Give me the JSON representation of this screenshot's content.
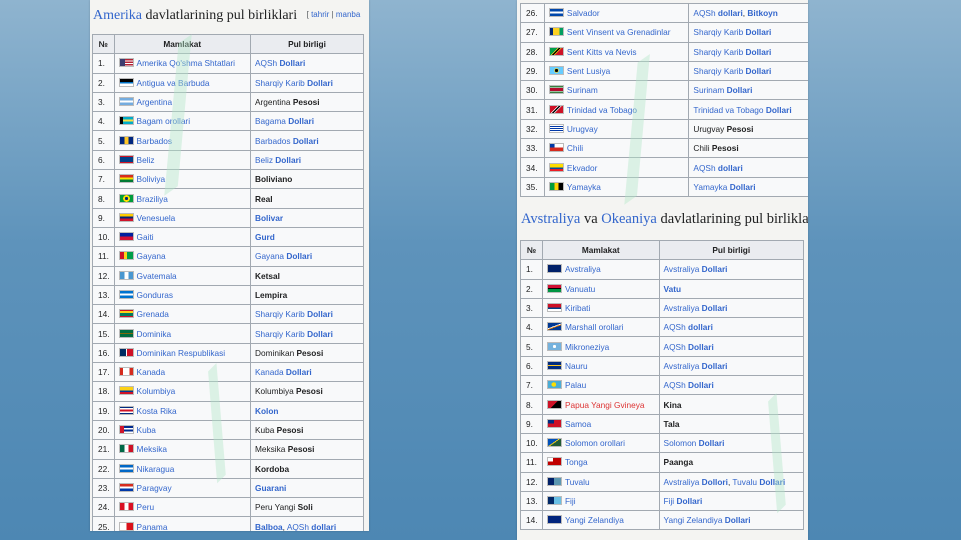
{
  "left_panel": {
    "title_link": "Amerika",
    "title_rest": " davlatlarining pul birliklari",
    "edit_link": "tahrir",
    "edit_sep": " | ",
    "source_link": "manba",
    "headers": [
      "№",
      "Mamlakat",
      "Pul birligi"
    ],
    "rows": [
      {
        "n": "1.",
        "country": "Amerika Qo'shma Shtatlari",
        "flag": "us",
        "cur": [
          {
            "t": "AQSh ",
            "l": 1
          },
          {
            "t": "Dollari",
            "l": 1,
            "b": 1
          }
        ]
      },
      {
        "n": "2.",
        "country": "Antigua va Barbuda",
        "flag": "ag",
        "cur": [
          {
            "t": "Sharqiy Karib ",
            "l": 1
          },
          {
            "t": "Dollari",
            "l": 1,
            "b": 1
          }
        ]
      },
      {
        "n": "3.",
        "country": "Argentina",
        "flag": "ar",
        "cur": [
          {
            "t": "Argentina "
          },
          {
            "t": "Pesosi",
            "b": 1
          }
        ]
      },
      {
        "n": "4.",
        "country": "Bagam orollari",
        "flag": "bs",
        "cur": [
          {
            "t": "Bagama ",
            "l": 1
          },
          {
            "t": "Dollari",
            "l": 1,
            "b": 1
          }
        ]
      },
      {
        "n": "5.",
        "country": "Barbados",
        "flag": "bb",
        "cur": [
          {
            "t": "Barbados ",
            "l": 1
          },
          {
            "t": "Dollari",
            "l": 1,
            "b": 1
          }
        ]
      },
      {
        "n": "6.",
        "country": "Beliz",
        "flag": "bz",
        "cur": [
          {
            "t": "Beliz ",
            "l": 1
          },
          {
            "t": "Dollari",
            "l": 1,
            "b": 1
          }
        ]
      },
      {
        "n": "7.",
        "country": "Boliviya",
        "flag": "bo",
        "cur": [
          {
            "t": "Boliviano",
            "b": 1
          }
        ]
      },
      {
        "n": "8.",
        "country": "Braziliya",
        "flag": "br",
        "cur": [
          {
            "t": "Real",
            "b": 1
          }
        ]
      },
      {
        "n": "9.",
        "country": "Venesuela",
        "flag": "ve",
        "cur": [
          {
            "t": "Bolivar",
            "l": 1,
            "b": 1
          }
        ]
      },
      {
        "n": "10.",
        "country": "Gaiti",
        "flag": "ht",
        "cur": [
          {
            "t": "Gurd",
            "l": 1,
            "b": 1
          }
        ]
      },
      {
        "n": "11.",
        "country": "Gayana",
        "flag": "gy",
        "cur": [
          {
            "t": "Gayana ",
            "l": 1
          },
          {
            "t": "Dollari",
            "l": 1,
            "b": 1
          }
        ]
      },
      {
        "n": "12.",
        "country": "Gvatemala",
        "flag": "gt",
        "cur": [
          {
            "t": "Ketsal",
            "b": 1
          }
        ]
      },
      {
        "n": "13.",
        "country": "Gonduras",
        "flag": "hn",
        "cur": [
          {
            "t": "Lempira",
            "b": 1
          }
        ]
      },
      {
        "n": "14.",
        "country": "Grenada",
        "flag": "gd",
        "cur": [
          {
            "t": "Sharqiy Karib ",
            "l": 1
          },
          {
            "t": "Dollari",
            "l": 1,
            "b": 1
          }
        ]
      },
      {
        "n": "15.",
        "country": "Dominika",
        "flag": "dm",
        "cur": [
          {
            "t": "Sharqiy Karib ",
            "l": 1
          },
          {
            "t": "Dollari",
            "l": 1,
            "b": 1
          }
        ]
      },
      {
        "n": "16.",
        "country": "Dominikan Respublikasi",
        "flag": "do",
        "cur": [
          {
            "t": "Dominikan "
          },
          {
            "t": "Pesosi",
            "b": 1
          }
        ]
      },
      {
        "n": "17.",
        "country": "Kanada",
        "flag": "ca",
        "cur": [
          {
            "t": "Kanada ",
            "l": 1
          },
          {
            "t": "Dollari",
            "l": 1,
            "b": 1
          }
        ]
      },
      {
        "n": "18.",
        "country": "Kolumbiya",
        "flag": "co",
        "cur": [
          {
            "t": "Kolumbiya "
          },
          {
            "t": "Pesosi",
            "b": 1
          }
        ]
      },
      {
        "n": "19.",
        "country": "Kosta Rika",
        "flag": "cr",
        "cur": [
          {
            "t": "Kolon",
            "l": 1,
            "b": 1
          }
        ]
      },
      {
        "n": "20.",
        "country": "Kuba",
        "flag": "cu",
        "cur": [
          {
            "t": "Kuba "
          },
          {
            "t": "Pesosi",
            "b": 1
          }
        ]
      },
      {
        "n": "21.",
        "country": "Meksika",
        "flag": "mx",
        "cur": [
          {
            "t": "Meksika "
          },
          {
            "t": "Pesosi",
            "b": 1
          }
        ]
      },
      {
        "n": "22.",
        "country": "Nikaragua",
        "flag": "ni",
        "cur": [
          {
            "t": "Kordoba",
            "b": 1
          }
        ]
      },
      {
        "n": "23.",
        "country": "Paragvay",
        "flag": "py",
        "cur": [
          {
            "t": "Guarani",
            "l": 1,
            "b": 1
          }
        ]
      },
      {
        "n": "24.",
        "country": "Peru",
        "flag": "pe",
        "cur": [
          {
            "t": "Peru Yangi "
          },
          {
            "t": "Soli",
            "b": 1
          }
        ]
      },
      {
        "n": "25.",
        "country": "Panama",
        "flag": "pa",
        "cur": [
          {
            "t": "Balboa",
            "l": 1,
            "b": 1
          },
          {
            "t": ", "
          },
          {
            "t": "AQSh ",
            "l": 1
          },
          {
            "t": "dollari",
            "l": 1,
            "b": 1
          }
        ]
      },
      {
        "n": "26.",
        "country": "Salvador",
        "flag": "sv",
        "cur": [
          {
            "t": "AQSh ",
            "l": 1
          },
          {
            "t": "dollari",
            "l": 1,
            "b": 1
          },
          {
            "t": ", "
          },
          {
            "t": "Bitkoyn",
            "l": 1,
            "b": 1
          }
        ]
      }
    ]
  },
  "right_panel": {
    "rows_top": [
      {
        "n": "26.",
        "country": "Salvador",
        "flag": "sv",
        "cur": [
          {
            "t": "AQSh ",
            "l": 1
          },
          {
            "t": "dollari",
            "l": 1,
            "b": 1
          },
          {
            "t": ", "
          },
          {
            "t": "Bitkoyn",
            "l": 1,
            "b": 1
          }
        ]
      },
      {
        "n": "27.",
        "country": "Sent Vinsent va Grenadinlar",
        "flag": "vc",
        "cur": [
          {
            "t": "Sharqiy Karib ",
            "l": 1
          },
          {
            "t": "Dollari",
            "l": 1,
            "b": 1
          }
        ]
      },
      {
        "n": "28.",
        "country": "Sent Kitts va Nevis",
        "flag": "kn",
        "cur": [
          {
            "t": "Sharqiy Karib ",
            "l": 1
          },
          {
            "t": "Dollari",
            "l": 1,
            "b": 1
          }
        ]
      },
      {
        "n": "29.",
        "country": "Sent Lusiya",
        "flag": "lc",
        "cur": [
          {
            "t": "Sharqiy Karib ",
            "l": 1
          },
          {
            "t": "Dollari",
            "l": 1,
            "b": 1
          }
        ]
      },
      {
        "n": "30.",
        "country": "Surinam",
        "flag": "sr",
        "cur": [
          {
            "t": "Surinam ",
            "l": 1
          },
          {
            "t": "Dollari",
            "l": 1,
            "b": 1
          }
        ]
      },
      {
        "n": "31.",
        "country": "Trinidad va Tobago",
        "flag": "tt",
        "cur": [
          {
            "t": "Trinidad va Tobago ",
            "l": 1
          },
          {
            "t": "Dollari",
            "l": 1,
            "b": 1
          }
        ]
      },
      {
        "n": "32.",
        "country": "Urugvay",
        "flag": "uy",
        "cur": [
          {
            "t": "Urugvay "
          },
          {
            "t": "Pesosi",
            "b": 1
          }
        ]
      },
      {
        "n": "33.",
        "country": "Chili",
        "flag": "cl",
        "cur": [
          {
            "t": "Chili "
          },
          {
            "t": "Pesosi",
            "b": 1
          }
        ]
      },
      {
        "n": "34.",
        "country": "Ekvador",
        "flag": "ec",
        "cur": [
          {
            "t": "AQSh ",
            "l": 1
          },
          {
            "t": "dollari",
            "l": 1,
            "b": 1
          }
        ]
      },
      {
        "n": "35.",
        "country": "Yamayka",
        "flag": "jm",
        "cur": [
          {
            "t": "Yamayka ",
            "l": 1
          },
          {
            "t": "Dollari",
            "l": 1,
            "b": 1
          }
        ]
      }
    ],
    "title_link1": "Avstraliya",
    "title_mid": " va ",
    "title_link2": "Okeaniya",
    "title_rest": " davlatlarining pul birliklari",
    "headers": [
      "№",
      "Mamlakat",
      "Pul birligi"
    ],
    "rows_bottom": [
      {
        "n": "1.",
        "country": "Avstraliya",
        "flag": "au",
        "cur": [
          {
            "t": "Avstraliya ",
            "l": 1
          },
          {
            "t": "Dollari",
            "l": 1,
            "b": 1
          }
        ]
      },
      {
        "n": "2.",
        "country": "Vanuatu",
        "flag": "vu",
        "cur": [
          {
            "t": "Vatu",
            "l": 1,
            "b": 1
          }
        ]
      },
      {
        "n": "3.",
        "country": "Kiribati",
        "flag": "ki",
        "cur": [
          {
            "t": "Avstraliya ",
            "l": 1
          },
          {
            "t": "Dollari",
            "l": 1,
            "b": 1
          }
        ]
      },
      {
        "n": "4.",
        "country": "Marshall orollari",
        "flag": "mh",
        "cur": [
          {
            "t": "AQSh ",
            "l": 1
          },
          {
            "t": "dollari",
            "l": 1,
            "b": 1
          }
        ]
      },
      {
        "n": "5.",
        "country": "Mikroneziya",
        "flag": "fm",
        "cur": [
          {
            "t": "AQSh ",
            "l": 1
          },
          {
            "t": "Dollari",
            "l": 1,
            "b": 1
          }
        ]
      },
      {
        "n": "6.",
        "country": "Nauru",
        "flag": "nr",
        "cur": [
          {
            "t": "Avstraliya ",
            "l": 1
          },
          {
            "t": "Dollari",
            "l": 1,
            "b": 1
          }
        ]
      },
      {
        "n": "7.",
        "country": "Palau",
        "flag": "pw",
        "cur": [
          {
            "t": "AQSh ",
            "l": 1
          },
          {
            "t": "Dollari",
            "l": 1,
            "b": 1
          }
        ]
      },
      {
        "n": "8.",
        "country": "Papua Yangi Gvineya",
        "flag": "pg",
        "red": 1,
        "cur": [
          {
            "t": "Kina",
            "b": 1
          }
        ]
      },
      {
        "n": "9.",
        "country": "Samoa",
        "flag": "ws",
        "cur": [
          {
            "t": "Tala",
            "b": 1
          }
        ]
      },
      {
        "n": "10.",
        "country": "Solomon orollari",
        "flag": "sb",
        "cur": [
          {
            "t": "Solomon ",
            "l": 1
          },
          {
            "t": "Dollari",
            "l": 1,
            "b": 1
          }
        ]
      },
      {
        "n": "11.",
        "country": "Tonga",
        "flag": "to",
        "cur": [
          {
            "t": "Paanga",
            "b": 1
          }
        ]
      },
      {
        "n": "12.",
        "country": "Tuvalu",
        "flag": "tv",
        "cur": [
          {
            "t": "Avstraliya ",
            "l": 1
          },
          {
            "t": "Dollori",
            "l": 1,
            "b": 1
          },
          {
            "t": ", "
          },
          {
            "t": "Tuvalu ",
            "l": 1
          },
          {
            "t": "Dollari",
            "l": 1,
            "b": 1
          }
        ]
      },
      {
        "n": "13.",
        "country": "Fiji",
        "flag": "fj",
        "cur": [
          {
            "t": "Fiji ",
            "l": 1
          },
          {
            "t": "Dollari",
            "l": 1,
            "b": 1
          }
        ]
      },
      {
        "n": "14.",
        "country": "Yangi Zelandiya",
        "flag": "nz",
        "cur": [
          {
            "t": "Yangi Zelandiya ",
            "l": 1
          },
          {
            "t": "Dollari",
            "l": 1,
            "b": 1
          }
        ]
      }
    ]
  },
  "flags": {
    "us": "linear-gradient(90deg,#3c3b6e 0 40%,transparent 40%),repeating-linear-gradient(180deg,#b22234 0 1.3px,#fff 1.3px 2.6px)",
    "ag": "linear-gradient(180deg,#000 0 40%,#0072c6 40% 65%,#fff 65%)",
    "ar": "linear-gradient(180deg,#74acdf 0 33%,#fff 33% 66%,#74acdf 66%)",
    "bs": "linear-gradient(90deg,#000 0 25%,transparent 25%),linear-gradient(180deg,#00abc9 0 33%,#fae042 33% 66%,#00abc9 66%)",
    "bb": "linear-gradient(90deg,#00267f 0 33%,#ffc726 33% 66%,#00267f 66%)",
    "bz": "linear-gradient(180deg,#ce1126 0 12%,#003f87 12% 88%,#ce1126 88%)",
    "bo": "linear-gradient(180deg,#d52b1e 0 33%,#f9e300 33% 66%,#007934 66%)",
    "br": "radial-gradient(circle,#002776 0 22%,#ffdf00 23% 45%,#009c3b 46%)",
    "ve": "linear-gradient(180deg,#ffcc00 0 33%,#00247d 33% 66%,#cf142b 66%)",
    "ht": "linear-gradient(180deg,#00209f 0 50%,#d21034 50%)",
    "gy": "linear-gradient(90deg,#ce1126 0 30%,#fcd116 30% 55%,#009e49 55%)",
    "gt": "linear-gradient(90deg,#4997d0 0 33%,#fff 33% 66%,#4997d0 66%)",
    "hn": "linear-gradient(180deg,#0073cf 0 33%,#fff 33% 66%,#0073cf 66%)",
    "gd": "linear-gradient(180deg,#ce1126 0 15%,#fcd116 15% 45%,#007a5e 45% 85%,#ce1126 85%)",
    "dm": "linear-gradient(180deg,#006b3f 0 40%,#fcd116 40% 50%,#000 50% 60%,#006b3f 60%)",
    "do": "linear-gradient(90deg,#002d62 0 45%,#fff 45% 55%,#ce1126 55%)",
    "ca": "linear-gradient(90deg,#d52b1e 0 25%,#fff 25% 75%,#d52b1e 75%)",
    "co": "linear-gradient(180deg,#fcd116 0 50%,#003893 50% 75%,#ce1126 75%)",
    "cr": "linear-gradient(180deg,#002b7f 0 17%,#fff 17% 33%,#ce1126 33% 67%,#fff 67% 83%,#002b7f 83%)",
    "cu": "linear-gradient(90deg,#cf142b 0 30%,transparent 30%),repeating-linear-gradient(180deg,#002a8f 0 1.8px,#fff 1.8px 3.6px)",
    "mx": "linear-gradient(90deg,#006847 0 33%,#fff 33% 66%,#ce1126 66%)",
    "ni": "linear-gradient(180deg,#0067c6 0 33%,#fff 33% 66%,#0067c6 66%)",
    "py": "linear-gradient(180deg,#d52b1e 0 33%,#fff 33% 66%,#0038a8 66%)",
    "pe": "linear-gradient(90deg,#d91023 0 33%,#fff 33% 66%,#d91023 66%)",
    "pa": "linear-gradient(90deg,#fff 0 50%,#da121a 50%)",
    "sv": "linear-gradient(180deg,#0047ab 0 33%,#fff 33% 66%,#0047ab 66%)",
    "vc": "linear-gradient(90deg,#002674 0 25%,#fcd022 25% 75%,#009e60 75%)",
    "kn": "linear-gradient(135deg,#009e49 0 40%,#fcd116 40% 45%,#000 45% 55%,#fcd116 55% 60%,#ce1126 60%)",
    "lc": "radial-gradient(circle,#000 0 20%,#fcd116 21% 30%,#66ccff 31%)",
    "sr": "linear-gradient(180deg,#377e3f 0 20%,#fff 20% 30%,#b40a2d 30% 70%,#fff 70% 80%,#377e3f 80%)",
    "tt": "linear-gradient(135deg,#ce1126 0 40%,#fff 40% 45%,#000 45% 55%,#fff 55% 60%,#ce1126 60%)",
    "uy": "repeating-linear-gradient(180deg,#fff 0 1px,#0038a8 1px 2px)",
    "cl": "linear-gradient(180deg,#0039a6 0 50%,transparent 50%) left/35% 100% no-repeat,linear-gradient(180deg,#fff 0 50%,#d52b1e 50%)",
    "ec": "linear-gradient(180deg,#ffdd00 0 50%,#034ea2 50% 75%,#ed1c24 75%)",
    "jm": "linear-gradient(90deg,#009b3a 0 35%,#fed100 35% 65%,#000 65%)",
    "au": "linear-gradient(90deg,#012169 0 100%)",
    "vu": "linear-gradient(180deg,#d21034 0 45%,#000 45% 55%,#009543 55%)",
    "ki": "linear-gradient(180deg,#ce1126 0 50%,#003f87 50% 75%,#fff 75%)",
    "mh": "linear-gradient(160deg,#003893 0 45%,#fff 45% 52%,#dd7500 52% 60%,#003893 60%)",
    "fm": "radial-gradient(circle,#fff 0 20%,#75b2dd 21%)",
    "nr": "linear-gradient(180deg,#002b7f 0 45%,#ffc61e 45% 55%,#002b7f 55%)",
    "pw": "radial-gradient(circle at 45% 50%,#ffde00 0 28%,#4aadd6 29%)",
    "pg": "linear-gradient(135deg,#ce1126 0 50%,#000 50%)",
    "ws": "linear-gradient(90deg,#002b7f 0 45%,transparent 45%) top/100% 50% no-repeat,linear-gradient(#ce1126 0 100%)",
    "sb": "linear-gradient(145deg,#0051ba 0 45%,#fcd116 45% 52%,#215b33 52%)",
    "to": "linear-gradient(90deg,#fff 0 40%,transparent 40%) top/100% 50% no-repeat,linear-gradient(#c10000 0 100%)",
    "tv": "linear-gradient(90deg,#012169 0 45%,#5b97b1 45%)",
    "fj": "linear-gradient(90deg,#002868 0 45%,#68bfe5 45%)",
    "nz": "linear-gradient(90deg,#00247d 0 100%)"
  }
}
